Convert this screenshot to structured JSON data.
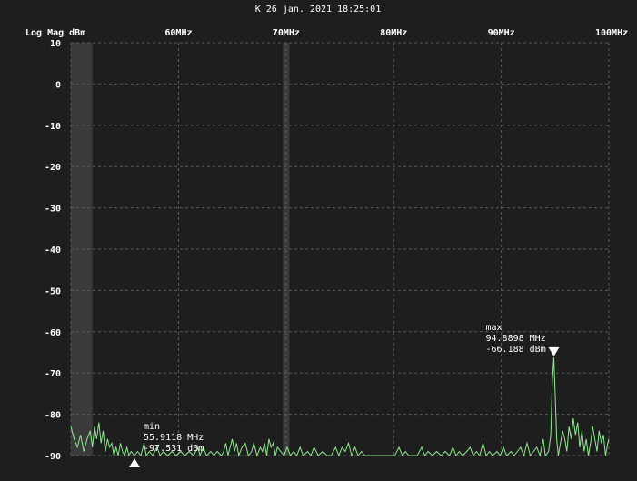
{
  "header": {
    "timestamp": "K 26 jan. 2021 18:25:01"
  },
  "colors": {
    "background": "#1e1e1e",
    "trace": "#8ee88e",
    "grid": "#5a5a5a",
    "band": "#3a3a3a",
    "text": "#ffffff"
  },
  "chart_data": {
    "type": "line",
    "title": "",
    "ylabel": "Log Mag dBm",
    "xlabel": "",
    "xlim": [
      50,
      100
    ],
    "ylim": [
      -90,
      10
    ],
    "grid": true,
    "x_ticks": [
      {
        "value": 60,
        "label": "60MHz"
      },
      {
        "value": 70,
        "label": "70MHz"
      },
      {
        "value": 80,
        "label": "80MHz"
      },
      {
        "value": 90,
        "label": "90MHz"
      },
      {
        "value": 100,
        "label": "100MHz"
      }
    ],
    "y_ticks": [
      {
        "value": 10,
        "label": "10"
      },
      {
        "value": 0,
        "label": "0"
      },
      {
        "value": -10,
        "label": "-10"
      },
      {
        "value": -20,
        "label": "-20"
      },
      {
        "value": -30,
        "label": "-30"
      },
      {
        "value": -40,
        "label": "-40"
      },
      {
        "value": -50,
        "label": "-50"
      },
      {
        "value": -60,
        "label": "-60"
      },
      {
        "value": -70,
        "label": "-70"
      },
      {
        "value": -80,
        "label": "-80"
      },
      {
        "value": -90,
        "label": "-90"
      }
    ],
    "shaded_bands": [
      {
        "x0": 50.0,
        "x1": 52.0
      },
      {
        "x0": 69.7,
        "x1": 70.3
      }
    ],
    "series": [
      {
        "points": [
          [
            50.0,
            -83
          ],
          [
            50.3,
            -86
          ],
          [
            50.6,
            -88
          ],
          [
            50.9,
            -85
          ],
          [
            51.2,
            -89
          ],
          [
            51.5,
            -86
          ],
          [
            51.8,
            -84
          ],
          [
            52.0,
            -88
          ],
          [
            52.2,
            -83
          ],
          [
            52.4,
            -86
          ],
          [
            52.6,
            -82
          ],
          [
            52.8,
            -87
          ],
          [
            53.0,
            -84
          ],
          [
            53.2,
            -89
          ],
          [
            53.4,
            -86
          ],
          [
            53.6,
            -88
          ],
          [
            53.8,
            -87
          ],
          [
            54.0,
            -90
          ],
          [
            54.2,
            -88
          ],
          [
            54.4,
            -90
          ],
          [
            54.6,
            -87
          ],
          [
            54.8,
            -89
          ],
          [
            55.0,
            -90
          ],
          [
            55.2,
            -88
          ],
          [
            55.4,
            -90
          ],
          [
            55.6,
            -89
          ],
          [
            55.9,
            -90
          ],
          [
            56.2,
            -89
          ],
          [
            56.5,
            -90
          ],
          [
            56.8,
            -87
          ],
          [
            57.0,
            -90
          ],
          [
            57.3,
            -89
          ],
          [
            57.6,
            -90
          ],
          [
            58.0,
            -88
          ],
          [
            58.3,
            -90
          ],
          [
            58.6,
            -89
          ],
          [
            59.0,
            -90
          ],
          [
            59.4,
            -89
          ],
          [
            59.8,
            -90
          ],
          [
            60.2,
            -89
          ],
          [
            60.6,
            -90
          ],
          [
            61.0,
            -89
          ],
          [
            61.4,
            -90
          ],
          [
            61.8,
            -88
          ],
          [
            62.0,
            -90
          ],
          [
            62.3,
            -88
          ],
          [
            62.6,
            -90
          ],
          [
            63.0,
            -89
          ],
          [
            63.3,
            -90
          ],
          [
            63.6,
            -89
          ],
          [
            64.0,
            -90
          ],
          [
            64.2,
            -89
          ],
          [
            64.4,
            -87
          ],
          [
            64.6,
            -90
          ],
          [
            64.8,
            -88
          ],
          [
            65.0,
            -86
          ],
          [
            65.2,
            -89
          ],
          [
            65.4,
            -87
          ],
          [
            65.6,
            -90
          ],
          [
            65.9,
            -88
          ],
          [
            66.2,
            -87
          ],
          [
            66.5,
            -90
          ],
          [
            66.8,
            -89
          ],
          [
            67.0,
            -87
          ],
          [
            67.3,
            -90
          ],
          [
            67.6,
            -88
          ],
          [
            67.8,
            -89
          ],
          [
            68.0,
            -87
          ],
          [
            68.2,
            -90
          ],
          [
            68.4,
            -86
          ],
          [
            68.6,
            -88
          ],
          [
            68.8,
            -87
          ],
          [
            69.0,
            -90
          ],
          [
            69.2,
            -88
          ],
          [
            69.5,
            -89
          ],
          [
            69.8,
            -90
          ],
          [
            70.1,
            -88
          ],
          [
            70.4,
            -90
          ],
          [
            70.7,
            -89
          ],
          [
            71.0,
            -90
          ],
          [
            71.3,
            -88
          ],
          [
            71.6,
            -90
          ],
          [
            72.0,
            -89
          ],
          [
            72.3,
            -90
          ],
          [
            72.6,
            -88
          ],
          [
            73.0,
            -90
          ],
          [
            73.4,
            -89
          ],
          [
            73.8,
            -90
          ],
          [
            74.2,
            -90
          ],
          [
            74.6,
            -88
          ],
          [
            74.9,
            -90
          ],
          [
            75.2,
            -88
          ],
          [
            75.5,
            -89
          ],
          [
            75.8,
            -87
          ],
          [
            76.1,
            -90
          ],
          [
            76.4,
            -88
          ],
          [
            76.7,
            -90
          ],
          [
            77.0,
            -89
          ],
          [
            77.3,
            -90
          ],
          [
            77.7,
            -90
          ],
          [
            78.1,
            -90
          ],
          [
            78.5,
            -90
          ],
          [
            78.9,
            -90
          ],
          [
            79.3,
            -90
          ],
          [
            79.7,
            -90
          ],
          [
            80.1,
            -90
          ],
          [
            80.5,
            -88
          ],
          [
            80.8,
            -90
          ],
          [
            81.1,
            -89
          ],
          [
            81.4,
            -90
          ],
          [
            81.8,
            -90
          ],
          [
            82.2,
            -90
          ],
          [
            82.6,
            -88
          ],
          [
            82.9,
            -90
          ],
          [
            83.2,
            -89
          ],
          [
            83.6,
            -90
          ],
          [
            84.0,
            -89
          ],
          [
            84.4,
            -90
          ],
          [
            84.8,
            -89
          ],
          [
            85.2,
            -90
          ],
          [
            85.5,
            -88
          ],
          [
            85.8,
            -90
          ],
          [
            86.1,
            -89
          ],
          [
            86.4,
            -90
          ],
          [
            86.8,
            -89
          ],
          [
            87.1,
            -88
          ],
          [
            87.4,
            -90
          ],
          [
            87.7,
            -89
          ],
          [
            88.0,
            -90
          ],
          [
            88.3,
            -87
          ],
          [
            88.6,
            -90
          ],
          [
            88.9,
            -89
          ],
          [
            89.2,
            -90
          ],
          [
            89.6,
            -89
          ],
          [
            89.9,
            -90
          ],
          [
            90.2,
            -88
          ],
          [
            90.5,
            -90
          ],
          [
            90.9,
            -89
          ],
          [
            91.2,
            -90
          ],
          [
            91.5,
            -89
          ],
          [
            91.8,
            -88
          ],
          [
            92.1,
            -90
          ],
          [
            92.4,
            -87
          ],
          [
            92.7,
            -90
          ],
          [
            93.0,
            -89
          ],
          [
            93.3,
            -88
          ],
          [
            93.6,
            -90
          ],
          [
            93.9,
            -86
          ],
          [
            94.1,
            -90
          ],
          [
            94.4,
            -89
          ],
          [
            94.6,
            -85
          ],
          [
            94.75,
            -72
          ],
          [
            94.89,
            -66.188
          ],
          [
            95.0,
            -74
          ],
          [
            95.15,
            -86
          ],
          [
            95.3,
            -90
          ],
          [
            95.5,
            -87
          ],
          [
            95.7,
            -84
          ],
          [
            95.9,
            -86
          ],
          [
            96.1,
            -89
          ],
          [
            96.3,
            -83
          ],
          [
            96.5,
            -86
          ],
          [
            96.7,
            -81
          ],
          [
            96.9,
            -85
          ],
          [
            97.1,
            -82
          ],
          [
            97.3,
            -88
          ],
          [
            97.5,
            -84
          ],
          [
            97.7,
            -89
          ],
          [
            97.9,
            -86
          ],
          [
            98.1,
            -90
          ],
          [
            98.3,
            -87
          ],
          [
            98.5,
            -83
          ],
          [
            98.7,
            -86
          ],
          [
            98.9,
            -89
          ],
          [
            99.1,
            -84
          ],
          [
            99.3,
            -87
          ],
          [
            99.5,
            -85
          ],
          [
            99.7,
            -90
          ],
          [
            99.9,
            -87
          ],
          [
            100.0,
            -86
          ]
        ]
      }
    ],
    "markers": [
      {
        "name": "min",
        "freq_label": "55.9118 MHz",
        "level_label": "-97.531 dBm",
        "x": 55.9118,
        "y": -90,
        "direction": "up"
      },
      {
        "name": "max",
        "freq_label": "94.8898 MHz",
        "level_label": "-66.188 dBm",
        "x": 94.8898,
        "y": -66.188,
        "direction": "down"
      }
    ]
  }
}
